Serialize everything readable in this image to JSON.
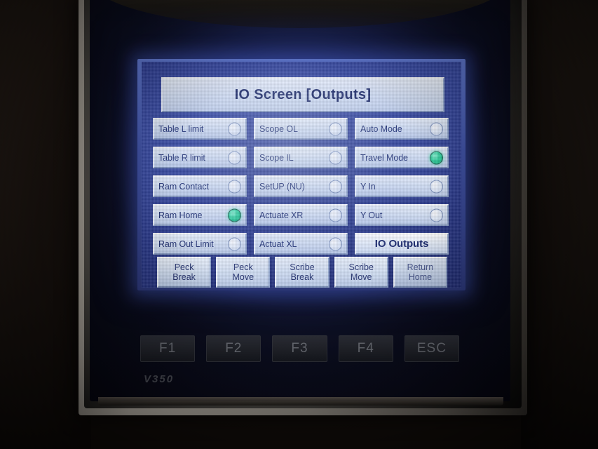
{
  "device": {
    "model_label": "V350"
  },
  "screen": {
    "title": "IO Screen [Outputs]"
  },
  "colors": {
    "led_on": "#2fd39b",
    "led_off": "#e6eefb",
    "panel_blue": "#2c3c96",
    "button_face": "#d4e0f3",
    "text_navy": "#1b2b6e"
  },
  "io_columns": [
    {
      "name": "column-1",
      "items": [
        {
          "label": "Table L limit",
          "state": "off"
        },
        {
          "label": "Table R limit",
          "state": "off"
        },
        {
          "label": "Ram Contact",
          "state": "off"
        },
        {
          "label": "Ram Home",
          "state": "on"
        },
        {
          "label": "Ram Out Limit",
          "state": "off"
        }
      ]
    },
    {
      "name": "column-2",
      "items": [
        {
          "label": "Scope OL",
          "state": "off"
        },
        {
          "label": "Scope IL",
          "state": "off"
        },
        {
          "label": "SetUP (NU)",
          "state": "off"
        },
        {
          "label": "Actuate XR",
          "state": "off"
        },
        {
          "label": "Actuat XL",
          "state": "off"
        }
      ]
    },
    {
      "name": "column-3",
      "items": [
        {
          "label": "Auto Mode",
          "state": "off"
        },
        {
          "label": "Travel Mode",
          "state": "on"
        },
        {
          "label": "Y In",
          "state": "off"
        },
        {
          "label": "Y Out",
          "state": "off"
        }
      ]
    }
  ],
  "nav_button": {
    "label": "IO Outputs",
    "selected": true
  },
  "action_buttons": [
    {
      "line1": "Peck",
      "line2": "Break",
      "dim": false
    },
    {
      "line1": "Peck",
      "line2": "Move",
      "dim": false
    },
    {
      "line1": "Scribe",
      "line2": "Break",
      "dim": false
    },
    {
      "line1": "Scribe",
      "line2": "Move",
      "dim": false
    },
    {
      "line1": "Return",
      "line2": "Home",
      "dim": true
    }
  ],
  "keypad": [
    {
      "label": "F1"
    },
    {
      "label": "F2"
    },
    {
      "label": "F3"
    },
    {
      "label": "F4"
    },
    {
      "label": "ESC"
    }
  ]
}
